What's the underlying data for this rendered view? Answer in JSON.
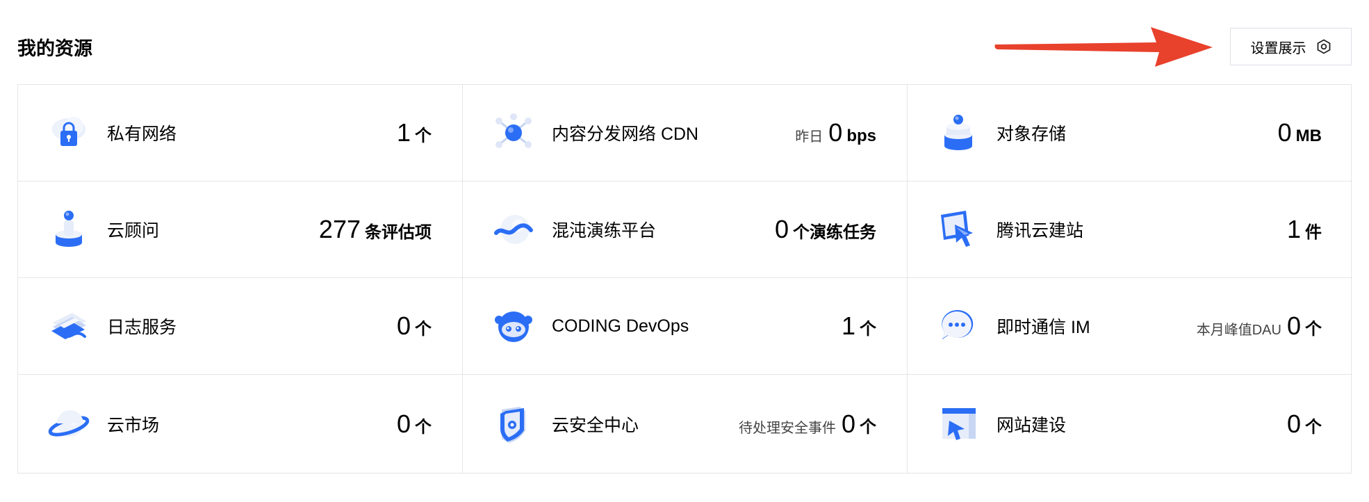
{
  "header": {
    "title": "我的资源",
    "settings_label": "设置展示",
    "settings_icon": "hexagon-settings-icon"
  },
  "annotation": {
    "arrow_color": "#e8412c"
  },
  "colors": {
    "accent": "#2b6ef5",
    "border": "#e5e5e5"
  },
  "resources": [
    {
      "name": "私有网络",
      "icon": "vpc-cloud-lock-icon",
      "prefix": "",
      "number": "1",
      "unit": "个"
    },
    {
      "name": "内容分发网络 CDN",
      "icon": "cdn-network-icon",
      "prefix": "昨日",
      "number": "0",
      "unit": "bps"
    },
    {
      "name": "对象存储",
      "icon": "object-storage-icon",
      "prefix": "",
      "number": "0",
      "unit": "MB"
    },
    {
      "name": "云顾问",
      "icon": "cloud-advisor-icon",
      "prefix": "",
      "number": "277",
      "unit": "条评估项"
    },
    {
      "name": "混沌演练平台",
      "icon": "chaos-platform-icon",
      "prefix": "",
      "number": "0",
      "unit": "个演练任务"
    },
    {
      "name": "腾讯云建站",
      "icon": "website-builder-icon",
      "prefix": "",
      "number": "1",
      "unit": "件"
    },
    {
      "name": "日志服务",
      "icon": "log-service-icon",
      "prefix": "",
      "number": "0",
      "unit": "个"
    },
    {
      "name": "CODING DevOps",
      "icon": "coding-devops-icon",
      "prefix": "",
      "number": "1",
      "unit": "个"
    },
    {
      "name": "即时通信 IM",
      "icon": "instant-messaging-icon",
      "prefix": "本月峰值DAU",
      "number": "0",
      "unit": "个"
    },
    {
      "name": "云市场",
      "icon": "cloud-market-planet-icon",
      "prefix": "",
      "number": "0",
      "unit": "个"
    },
    {
      "name": "云安全中心",
      "icon": "security-shield-icon",
      "prefix": "待处理安全事件",
      "number": "0",
      "unit": "个"
    },
    {
      "name": "网站建设",
      "icon": "website-building-icon",
      "prefix": "",
      "number": "0",
      "unit": "个"
    }
  ]
}
